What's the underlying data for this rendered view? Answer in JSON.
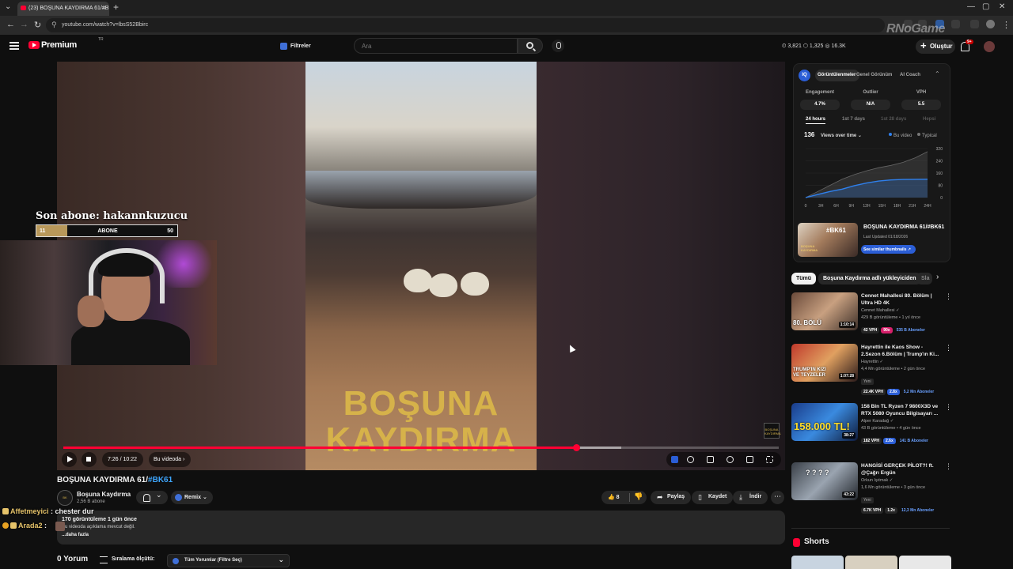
{
  "browser": {
    "tab_title": "(23) BOŞUNA KAYDIRMA 61/#B",
    "url": "youtube.com/watch?v=lbsS52Bbirc"
  },
  "masthead": {
    "logo_text": "Premium",
    "region": "TR",
    "filters_label": "Filtreler",
    "search_placeholder": "Ara",
    "stats": "⏲ 3,821  ⬡ 1,325  ◎ 16.3K",
    "create_label": "Oluştur",
    "notif_count": "9+",
    "watermark": "RNoGame"
  },
  "overlay": {
    "last_sub_label": "Son abone: hakannkuzucu",
    "sub_current": "11",
    "sub_label": "ABONE",
    "sub_goal": "50",
    "sub_progress": 0.22
  },
  "player": {
    "video_text_line1": "BOŞUNA",
    "video_text_line2": "KAYDIRMA",
    "channel_watermark": "BOŞUNA KAYDIRMA",
    "time": "7:26 / 10:22",
    "chapter": "Bu videoda",
    "progress": 0.717,
    "buffered": 0.78
  },
  "video": {
    "title": "BOŞUNA KAYDIRMA 61/",
    "hashtag": "#BK61",
    "channel_name": "Boşuna Kaydırma",
    "channel_subs": "2,56 B abone",
    "remix_label": "Remix",
    "like_count": "8",
    "share_label": "Paylaş",
    "save_label": "Kaydet",
    "download_label": "İndir",
    "desc_meta": "170 görüntüleme  1 gün önce",
    "desc_text": "Bu videoda açıklama mevcut değil.",
    "desc_more": "...daha fazla"
  },
  "chat": [
    {
      "name": "Affetmeyici",
      "text": " : chester dur"
    },
    {
      "name": "Arada2",
      "text": " :"
    }
  ],
  "comments": {
    "count_label": "0 Yorum",
    "sort_label": "Sıralama ölçütü:",
    "filter_label": "Tüm Yorumlar (Filtre Seç)"
  },
  "panel": {
    "logo": "IQ",
    "tabs": [
      "Görüntülenmeler",
      "Genel Görünüm",
      "AI Coach"
    ],
    "metrics": [
      {
        "label": "Engagement",
        "value": "4.7%"
      },
      {
        "label": "Outlier",
        "value": "N/A"
      },
      {
        "label": "VPH",
        "value": "5.5"
      }
    ],
    "ranges": [
      "24 hours",
      "1st 7 days",
      "1st 28 days",
      "Hepsi"
    ],
    "views_total": "136",
    "views_dropdown": "Views over time ⌄",
    "legend_this": "Bu video",
    "legend_typical": "Typical",
    "thumb_tag": "#BK61",
    "thumb_words": "BOŞUNA KAYDIRMA",
    "video_title": "BOŞUNA KAYDIRMA 61/#BK61",
    "last_updated": "Last Updated 01/18/2026",
    "similar_label": "See similar thumbnails ↗",
    "accent": "#2b5ed6"
  },
  "chart_data": {
    "type": "area",
    "x": [
      "0",
      "3H",
      "6H",
      "9H",
      "12H",
      "15H",
      "18H",
      "21H",
      "24H"
    ],
    "yticks": [
      "320",
      "240",
      "160",
      "80",
      "0"
    ],
    "ylim": [
      0,
      320
    ],
    "series": [
      {
        "name": "Bu video",
        "color": "#2f80ed",
        "values": [
          0,
          20,
          40,
          55,
          78,
          95,
          108,
          115,
          118,
          119,
          120
        ]
      },
      {
        "name": "Typical",
        "color": "#777777",
        "values": [
          0,
          40,
          80,
          120,
          150,
          175,
          195,
          210,
          230,
          260,
          300
        ]
      }
    ]
  },
  "chips": [
    "Tümü",
    "Boşuna Kaydırma adlı yükleyiciden",
    "Sla"
  ],
  "recommendations": [
    {
      "title": "Cennet Mahallesi 80. Bölüm | Ultra HD 4K",
      "channel": "Cennet Mahallesi",
      "meta": "429 B görüntüleme • 1 yıl önce",
      "duration": "1:10:14",
      "thumb_text": "80. BÖLÜ",
      "pills": [
        "42 VPH",
        "90x",
        "535 B Aboneler"
      ],
      "pill_colors": [
        "#262626",
        "#d6206a",
        "#262626"
      ],
      "new": ""
    },
    {
      "title": "Hayrettin ile Kaos Show - 2.Sezon 6.Bölüm | Trump'ın Ki...",
      "channel": "Hayrettin",
      "meta": "4,4 Mn görüntüleme • 2 gün önce",
      "duration": "1:07:28",
      "thumb_text": "TRUMP'IN KIZI VE TEYZELER",
      "pills": [
        "22.4K VPH",
        "2.8x",
        "5,2 Mn Aboneler"
      ],
      "pill_colors": [
        "#262626",
        "#2b5ed6",
        "#262626"
      ],
      "new": "Yeni"
    },
    {
      "title": "158 Bin TL Ryzen 7 9800X3D ve RTX 5080 Oyuncu Bilgisayarı ...",
      "channel": "Alper Karadağ",
      "meta": "43 B görüntüleme • 4 gün önce",
      "duration": "38:27",
      "thumb_text": "158.000 TL!",
      "pills": [
        "182 VPH",
        "2.6x",
        "141 B Aboneler"
      ],
      "pill_colors": [
        "#262626",
        "#2b5ed6",
        "#262626"
      ],
      "new": ""
    },
    {
      "title": "HANGİSİ GERÇEK PİLOT?! ft. @Çağrı Ergün",
      "channel": "Orkun Işıtmak",
      "meta": "1,6 Mn görüntüleme • 3 gün önce",
      "duration": "43:22",
      "thumb_text": "?  ?  ?  ?",
      "pills": [
        "6.7K VPH",
        "1.2x",
        "12,3 Mn Aboneler"
      ],
      "pill_colors": [
        "#262626",
        "#262626",
        "#262626"
      ],
      "new": "Yeni"
    }
  ],
  "shorts_label": "Shorts"
}
